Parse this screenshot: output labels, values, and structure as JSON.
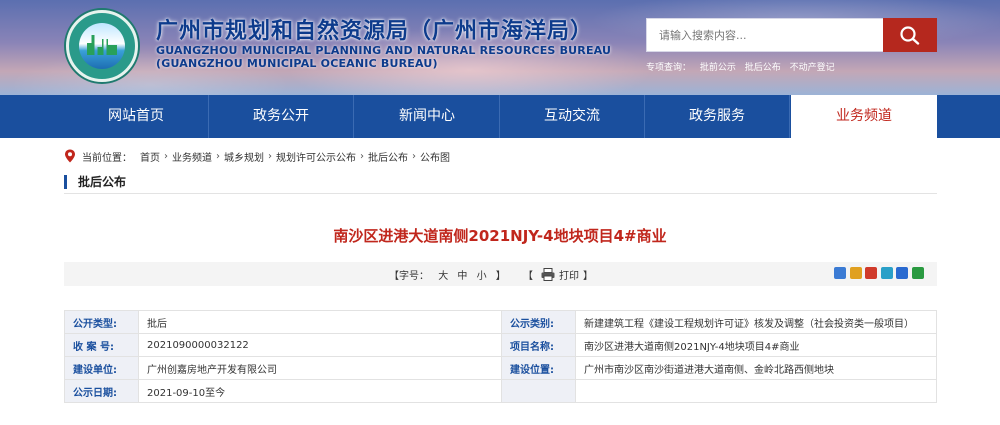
{
  "header": {
    "title_cn": "广州市规划和自然资源局（广州市海洋局）",
    "title_en_1": "GUANGZHOU MUNICIPAL PLANNING AND NATURAL RESOURCES BUREAU",
    "title_en_2": "(GUANGZHOU MUNICIPAL OCEANIC BUREAU)",
    "search_placeholder": "请输入搜索内容...",
    "quick_label": "专项查询：",
    "quick_links": [
      "批前公示",
      "批后公布",
      "不动产登记"
    ]
  },
  "nav": {
    "items": [
      "网站首页",
      "政务公开",
      "新闻中心",
      "互动交流",
      "政务服务",
      "业务频道"
    ],
    "active_index": 5
  },
  "breadcrumb": {
    "prefix": "当前位置：",
    "items": [
      "首页",
      "业务频道",
      "城乡规划",
      "规划许可公示公布",
      "批后公布",
      "公布图"
    ],
    "separator": "›"
  },
  "section": {
    "label": "批后公布"
  },
  "article": {
    "title": "南沙区进港大道南侧2021NJY-4地块项目4#商业"
  },
  "toolbar": {
    "font_label": "【字号：",
    "font_big": "大",
    "font_mid": "中",
    "font_small": "小",
    "font_close": "】",
    "print_open": "【",
    "print_label": "打印",
    "print_close": "】",
    "share_colors": [
      "#3b7bd4",
      "#e0a020",
      "#d03a2a",
      "#2aa0c8",
      "#2a6ad0",
      "#2a9a40"
    ]
  },
  "info": {
    "rows": [
      {
        "k1": "公开类型:",
        "v1": "批后",
        "k2": "公示类别:",
        "v2": "新建建筑工程《建设工程规划许可证》核发及调整（社会投资类一般项目）"
      },
      {
        "k1": "收 案 号:",
        "v1": "2021090000032122",
        "k2": "项目名称:",
        "v2": "南沙区进港大道南侧2021NJY-4地块项目4#商业"
      },
      {
        "k1": "建设单位:",
        "v1": "广州创嘉房地产开发有限公司",
        "k2": "建设位置:",
        "v2": "广州市南沙区南沙街道进港大道南侧、金岭北路西侧地块"
      },
      {
        "k1": "公示日期:",
        "v1": "2021-09-10至今",
        "k2": "",
        "v2": ""
      }
    ]
  }
}
